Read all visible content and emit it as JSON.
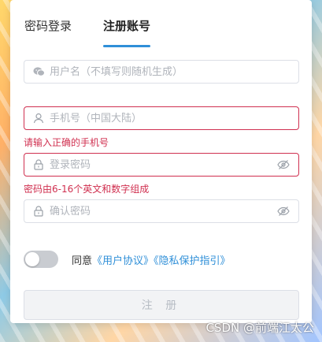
{
  "tabs": [
    {
      "label": "密码登录"
    },
    {
      "label": "注册账号"
    }
  ],
  "active_tab": "注册账号",
  "form": {
    "username": {
      "placeholder": "用户名（不填写则随机生成）",
      "icon": "wechat-icon"
    },
    "phone": {
      "placeholder": "手机号（中国大陆）",
      "icon": "user-icon",
      "error": "请输入正确的手机号"
    },
    "password": {
      "placeholder": "登录密码",
      "icon": "lock-icon",
      "error": "密码由6-16个英文和数字组成"
    },
    "confirm": {
      "placeholder": "确认密码",
      "icon": "lock-icon"
    }
  },
  "agreement": {
    "prefix": "同意",
    "user_agreement": "《用户协议》",
    "privacy": "《隐私保护指引》",
    "toggle_on": false
  },
  "submit_label": "注 册",
  "watermark": "CSDN @前端江太公",
  "colors": {
    "accent": "#2f8fd8",
    "error": "#d03050",
    "toggle_off": "#c9ccd1"
  }
}
